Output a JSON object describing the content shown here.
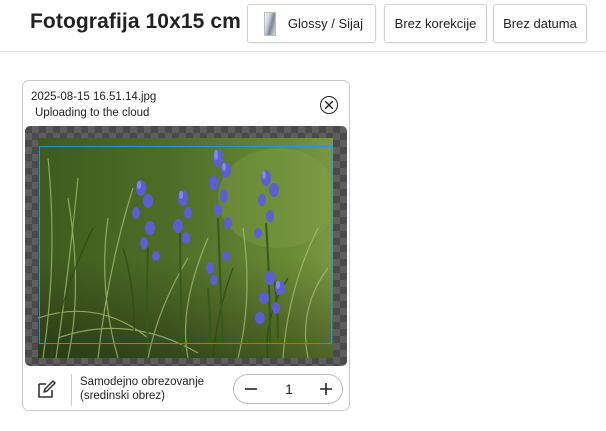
{
  "header": {
    "title": "Fotografija 10x15 cm",
    "paper_label": "Glossy / Sijaj",
    "correction_label": "Brez korekcije",
    "date_label": "Brez datuma"
  },
  "photo_card": {
    "filename": "2025-08-15 16.51.14.jpg",
    "status": "Uploading to the cloud",
    "crop_line1": "Samodejno obrezovanje",
    "crop_line2": "(sredinski obrez)",
    "quantity": "1",
    "image_subject": "photo-of-purple-gentian-flowers-in-grass"
  },
  "icons": {
    "paper": "glossy-paper-icon",
    "close": "close-circle-icon",
    "edit": "pencil-edit-icon",
    "minus": "minus-icon",
    "plus": "plus-icon"
  },
  "colors": {
    "crop_frame": "#2f8fe6",
    "checker_dark": "#4a4a4a",
    "checker_light": "#5e5e5e"
  }
}
